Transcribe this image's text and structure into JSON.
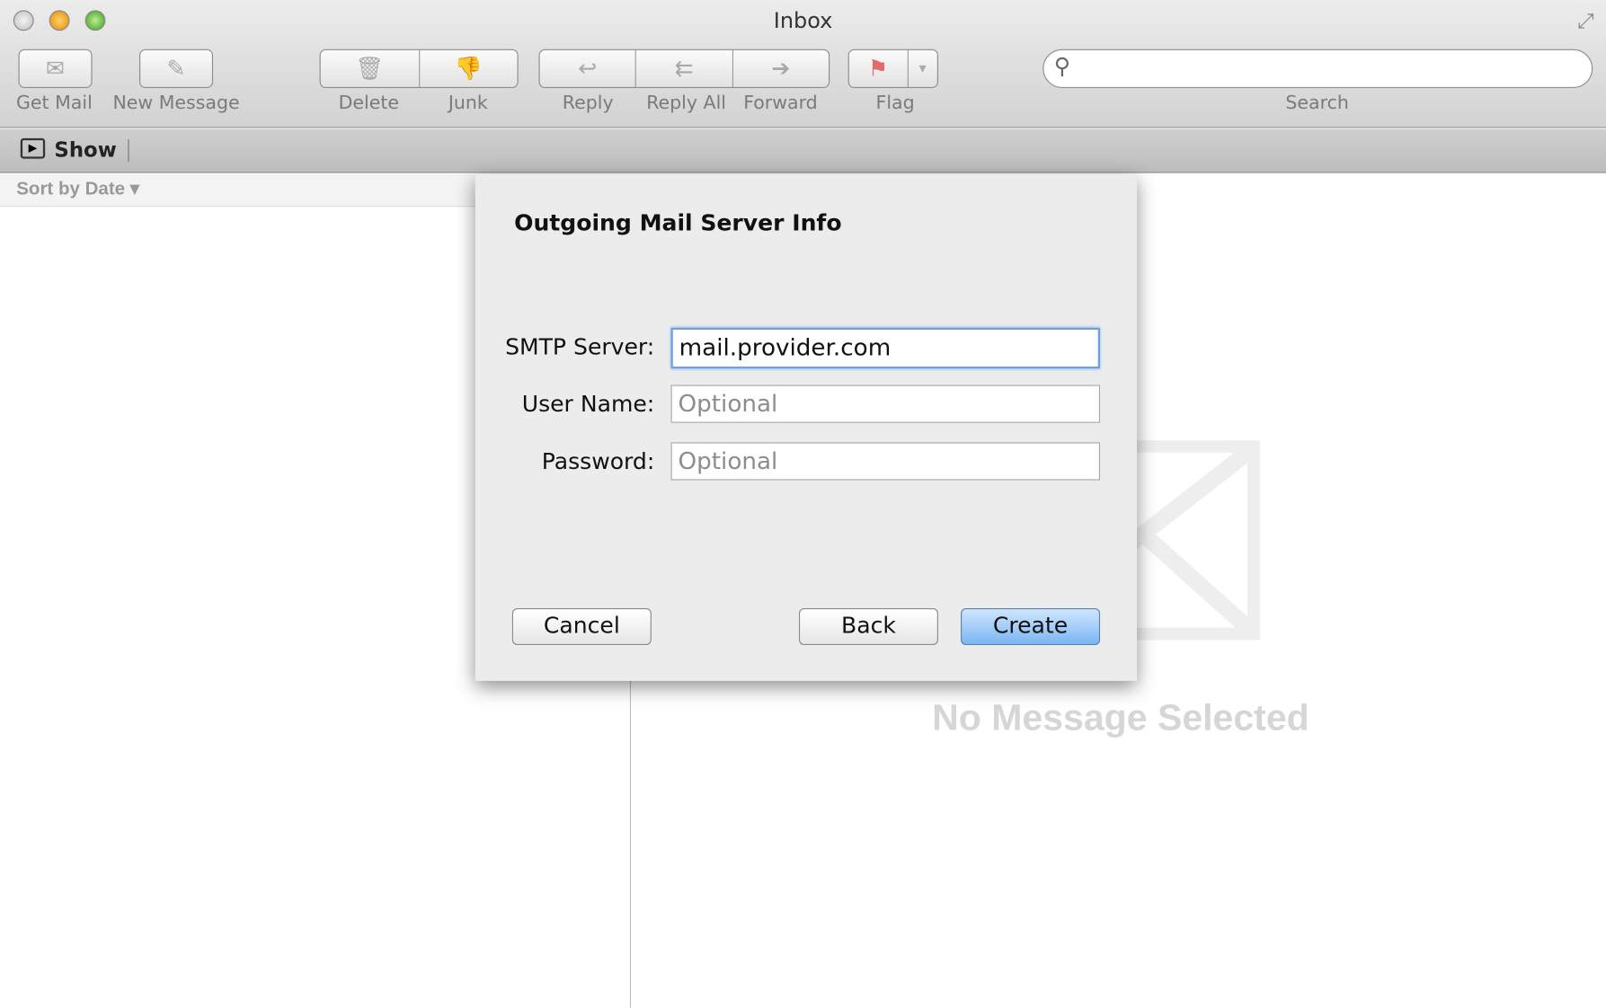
{
  "window": {
    "title": "Inbox"
  },
  "toolbar": {
    "get_mail": "Get Mail",
    "new_message": "New Message",
    "delete": "Delete",
    "junk": "Junk",
    "reply": "Reply",
    "reply_all": "Reply All",
    "forward": "Forward",
    "flag": "Flag",
    "search": "Search"
  },
  "showbar": {
    "show": "Show"
  },
  "list": {
    "sort": "Sort by Date ▾"
  },
  "viewer": {
    "empty": "No Message Selected"
  },
  "dialog": {
    "title": "Outgoing Mail Server Info",
    "smtp_label": "SMTP Server:",
    "smtp_value": "mail.provider.com",
    "user_label": "User Name:",
    "user_placeholder": "Optional",
    "pass_label": "Password:",
    "pass_placeholder": "Optional",
    "cancel": "Cancel",
    "back": "Back",
    "create": "Create"
  },
  "colors": {
    "accent": "#7ab6f3",
    "close": "#d0d0d0",
    "minimize": "#f5a623",
    "zoom": "#6cc04a"
  }
}
